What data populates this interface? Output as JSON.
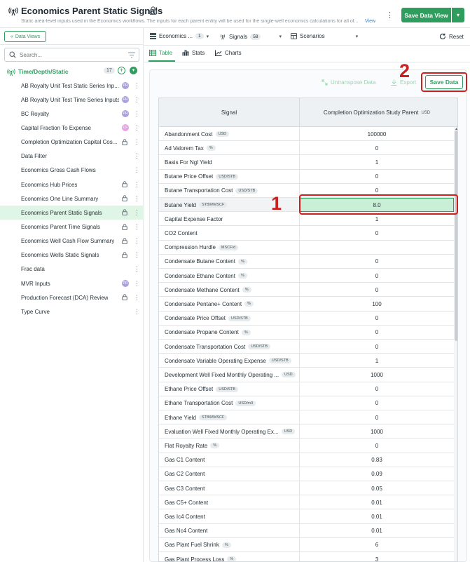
{
  "header": {
    "title": "Economics Parent Static Signals",
    "description": "Static area-level inputs used in the Economics workflows. The inputs for each parent entity will be used for the single-well economics calculations for all of...",
    "view_link": "View",
    "save_view_label": "Save Data View"
  },
  "sidebar": {
    "data_views_label": "Data Views",
    "search_placeholder": "Search...",
    "group": {
      "label": "Time/Depth/Static",
      "count": "17"
    },
    "items": [
      {
        "label": "AB Royalty Unit Test Static Series Inp...",
        "badge": "PR",
        "badge_color": "#a9a2d9"
      },
      {
        "label": "AB Royalty Unit Test Time Series Inputs",
        "badge": "PR",
        "badge_color": "#a9a2d9"
      },
      {
        "label": "BC Royalty",
        "badge": "PR",
        "badge_color": "#a9a2d9"
      },
      {
        "label": "Capital Fraction To Expense",
        "badge": "CF",
        "badge_color": "#e3a3e0"
      },
      {
        "label": "Completion Optimization Capital Cos...",
        "badge": "lock"
      },
      {
        "label": "Data Filter",
        "badge": ""
      },
      {
        "label": "Economics Gross Cash Flows",
        "badge": ""
      },
      {
        "label": "Economics Hub Prices",
        "badge": "lock"
      },
      {
        "label": "Economics One Line Summary",
        "badge": "lock"
      },
      {
        "label": "Economics Parent Static Signals",
        "badge": "lock",
        "active": true
      },
      {
        "label": "Economics Parent Time Signals",
        "badge": "lock"
      },
      {
        "label": "Economics Well Cash Flow Summary",
        "badge": "lock"
      },
      {
        "label": "Economics Wells Static Signals",
        "badge": "lock"
      },
      {
        "label": "Frac data",
        "badge": ""
      },
      {
        "label": "MVR Inputs",
        "badge": "PR",
        "badge_color": "#a9a2d9"
      },
      {
        "label": "Production Forecast (DCA) Review",
        "badge": "lock"
      },
      {
        "label": "Type Curve",
        "badge": ""
      }
    ]
  },
  "toolbar": {
    "economics_label": "Economics ...",
    "economics_count": "1",
    "signals_label": "Signals",
    "signals_count": "58",
    "scenarios_label": "Scenarios",
    "reset_label": "Reset"
  },
  "tabs": {
    "table": "Table",
    "stats": "Stats",
    "charts": "Charts"
  },
  "actions": {
    "untranspose_label": "Untranspose Data",
    "export_label": "Export",
    "save_data_label": "Save Data"
  },
  "annotations": {
    "marker_1": "1",
    "marker_2": "2"
  },
  "grid": {
    "signal_header": "Signal",
    "column_header": "Completion Optimization Study Parent",
    "column_unit": "USD",
    "rows": [
      {
        "name": "Abandonment Cost",
        "unit": "USD",
        "value": "100000"
      },
      {
        "name": "Ad Valorem Tax",
        "unit": "%",
        "value": "0"
      },
      {
        "name": "Basis For Ngl Yield",
        "unit": "",
        "value": "1"
      },
      {
        "name": "Butane Price Offset",
        "unit": "USD/STB",
        "value": "0"
      },
      {
        "name": "Butane Transportation Cost",
        "unit": "USD/STB",
        "value": "0"
      },
      {
        "name": "Butane Yield",
        "unit": "STB/MMSCF",
        "value": "8.0",
        "selected": true
      },
      {
        "name": "Capital Expense Factor",
        "unit": "",
        "value": "1"
      },
      {
        "name": "CO2 Content",
        "unit": "",
        "value": "0"
      },
      {
        "name": "Compression Hurdle",
        "unit": "MSCF/d",
        "value": ""
      },
      {
        "name": "Condensate Butane Content",
        "unit": "%",
        "value": "0"
      },
      {
        "name": "Condensate Ethane Content",
        "unit": "%",
        "value": "0"
      },
      {
        "name": "Condensate Methane Content",
        "unit": "%",
        "value": "0"
      },
      {
        "name": "Condensate Pentane+ Content",
        "unit": "%",
        "value": "100"
      },
      {
        "name": "Condensate Price Offset",
        "unit": "USD/STB",
        "value": "0"
      },
      {
        "name": "Condensate Propane Content",
        "unit": "%",
        "value": "0"
      },
      {
        "name": "Condensate Transportation Cost",
        "unit": "USD/STB",
        "value": "0"
      },
      {
        "name": "Condensate Variable Operating Expense",
        "unit": "USD/STB",
        "value": "1"
      },
      {
        "name": "Development Well Fixed Monthly Operating ...",
        "unit": "USD",
        "value": "1000"
      },
      {
        "name": "Ethane Price Offset",
        "unit": "USD/STB",
        "value": "0"
      },
      {
        "name": "Ethane Transportation Cost",
        "unit": "USD/m3",
        "value": "0"
      },
      {
        "name": "Ethane Yield",
        "unit": "STB/MMSCF",
        "value": "0"
      },
      {
        "name": "Evaluation Well Fixed Monthly Operating Ex...",
        "unit": "USD",
        "value": "1000"
      },
      {
        "name": "Flat Royalty Rate",
        "unit": "%",
        "value": "0"
      },
      {
        "name": "Gas C1 Content",
        "unit": "",
        "value": "0.83"
      },
      {
        "name": "Gas C2 Content",
        "unit": "",
        "value": "0.09"
      },
      {
        "name": "Gas C3 Content",
        "unit": "",
        "value": "0.05"
      },
      {
        "name": "Gas C5+ Content",
        "unit": "",
        "value": "0.01"
      },
      {
        "name": "Gas Ic4 Content",
        "unit": "",
        "value": "0.01"
      },
      {
        "name": "Gas Nc4 Content",
        "unit": "",
        "value": "0.01"
      },
      {
        "name": "Gas Plant Fuel Shrink",
        "unit": "%",
        "value": "6"
      },
      {
        "name": "Gas Plant Process Loss",
        "unit": "%",
        "value": "3"
      }
    ]
  }
}
